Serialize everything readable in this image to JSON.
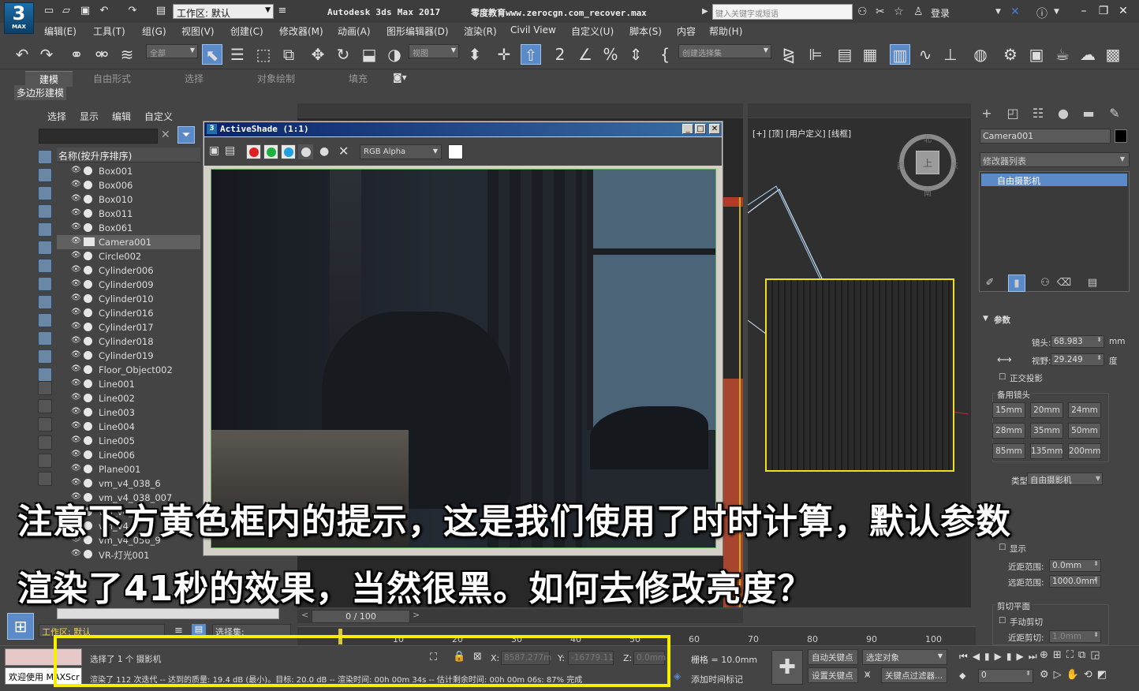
{
  "app": {
    "logo_text": "3",
    "logo_sub": "MAX",
    "workspace_label": "工作区: 默认",
    "title": "Autodesk 3ds Max 2017",
    "file_title": "零度教育www.zerocgn.com_recover.max",
    "search_placeholder": "键入关键字或短语",
    "login": "登录"
  },
  "menu": [
    "编辑(E)",
    "工具(T)",
    "组(G)",
    "视图(V)",
    "创建(C)",
    "修改器(M)",
    "动画(A)",
    "图形编辑器(D)",
    "渲染(R)",
    "Civil View",
    "自定义(U)",
    "脚本(S)",
    "内容",
    "帮助(H)"
  ],
  "toolbar": {
    "filter_all": "全部",
    "ref_coord": "视图",
    "named_sel": "创建选择集"
  },
  "ribbon": {
    "tabs": [
      "建模",
      "自由形式",
      "选择",
      "对象绘制",
      "填充"
    ],
    "sub": "多边形建模"
  },
  "explorer": {
    "menus": [
      "选择",
      "显示",
      "编辑",
      "自定义"
    ],
    "header": "名称(按升序排序)",
    "rows": [
      "Box001",
      "Box006",
      "Box010",
      "Box011",
      "Box061",
      "Camera001",
      "Circle002",
      "Cylinder006",
      "Cylinder009",
      "Cylinder010",
      "Cylinder016",
      "Cylinder017",
      "Cylinder018",
      "Cylinder019",
      "Floor_Object002",
      "Line001",
      "Line002",
      "Line003",
      "Line004",
      "Line005",
      "Line006",
      "Plane001",
      "vm_v4_038_6",
      "vm_v4_038_007",
      "vm_v4_03",
      "vm_v4_0",
      "vm_v4_056_9",
      "VR-灯光001"
    ],
    "selected_index": 5
  },
  "viewport": {
    "right_label": "[+] [顶] [用户定义] [线框]",
    "cube_top": "上",
    "cube_n": "北",
    "cube_s": "南",
    "cube_w": "西",
    "cube_e": "东"
  },
  "activeshade": {
    "title": "ActiveShade  (1:1)",
    "channel": "RGB Alpha"
  },
  "command_panel": {
    "object_name": "Camera001",
    "modifier_list": "修改器列表",
    "stack_item": "自由摄影机",
    "params_title": "参数",
    "lens_label": "镜头:",
    "lens_value": "68.983",
    "lens_unit": "mm",
    "fov_label": "视野:",
    "fov_value": "29.249",
    "fov_unit": "度",
    "ortho": "正交投影",
    "stock_lenses": "备用镜头",
    "lenses": [
      "15mm",
      "20mm",
      "24mm",
      "28mm",
      "35mm",
      "50mm",
      "85mm",
      "135mm",
      "200mm"
    ],
    "type_label": "类型:",
    "type_value": "自由摄影机",
    "show": "显示",
    "near_label": "近距范围:",
    "near_value": "0.0mm",
    "far_label": "远距范围:",
    "far_value": "1000.0mm",
    "clip_title": "剪切平面",
    "manual_clip": "手动剪切",
    "near_clip_label": "近距剪切:",
    "near_clip_value": "1.0mm"
  },
  "timeline": {
    "frame_label": "0 / 100",
    "ticks": [
      "10",
      "20",
      "30",
      "40",
      "50",
      "60",
      "70",
      "80",
      "90",
      "100"
    ]
  },
  "status": {
    "workspace": "工作区: 默认",
    "selection_set": "选择集:",
    "maxscript_label": "欢迎使用 MAXScr",
    "line1": "选择了 1 个 摄影机",
    "line2": "渲染了 112 次迭代 -- 达到的质量: 19.4 dB (最小)。目标: 20.0 dB -- 渲染时间: 00h 00m 34s -- 估计剩余时间: 00h 00m 06s: 87% 完成",
    "x_label": "X:",
    "x_value": "8587.277m",
    "y_label": "Y:",
    "y_value": "-16779.11",
    "z_label": "Z:",
    "z_value": "0.0mm",
    "grid": "栅格 = 10.0mm",
    "add_time_tag": "添加时间标记",
    "auto_key": "自动关键点",
    "set_key": "设置关键点",
    "selected": "选定对象",
    "key_filters": "关键点过滤器...",
    "frame_value": "0"
  },
  "captions": {
    "line1": "注意下方黄色框内的提示，这是我们使用了时时计算，默认参数",
    "line2": "渲染了41秒的效果，当然很黑。如何去修改亮度？"
  },
  "colors": {
    "highlight": "#f6f000",
    "selection_blue": "#5b8ac8",
    "panel_bg": "#444444"
  }
}
